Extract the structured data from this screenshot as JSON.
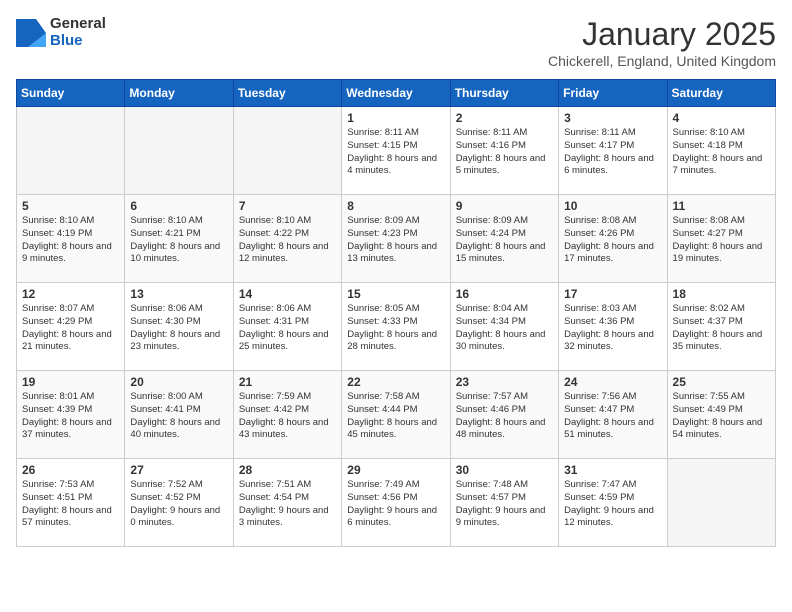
{
  "header": {
    "logo_general": "General",
    "logo_blue": "Blue",
    "month": "January 2025",
    "location": "Chickerell, England, United Kingdom"
  },
  "weekdays": [
    "Sunday",
    "Monday",
    "Tuesday",
    "Wednesday",
    "Thursday",
    "Friday",
    "Saturday"
  ],
  "weeks": [
    [
      {
        "day": null,
        "sunrise": null,
        "sunset": null,
        "daylight": null
      },
      {
        "day": null,
        "sunrise": null,
        "sunset": null,
        "daylight": null
      },
      {
        "day": null,
        "sunrise": null,
        "sunset": null,
        "daylight": null
      },
      {
        "day": "1",
        "sunrise": "8:11 AM",
        "sunset": "4:15 PM",
        "daylight": "8 hours and 4 minutes."
      },
      {
        "day": "2",
        "sunrise": "8:11 AM",
        "sunset": "4:16 PM",
        "daylight": "8 hours and 5 minutes."
      },
      {
        "day": "3",
        "sunrise": "8:11 AM",
        "sunset": "4:17 PM",
        "daylight": "8 hours and 6 minutes."
      },
      {
        "day": "4",
        "sunrise": "8:10 AM",
        "sunset": "4:18 PM",
        "daylight": "8 hours and 7 minutes."
      }
    ],
    [
      {
        "day": "5",
        "sunrise": "8:10 AM",
        "sunset": "4:19 PM",
        "daylight": "8 hours and 9 minutes."
      },
      {
        "day": "6",
        "sunrise": "8:10 AM",
        "sunset": "4:21 PM",
        "daylight": "8 hours and 10 minutes."
      },
      {
        "day": "7",
        "sunrise": "8:10 AM",
        "sunset": "4:22 PM",
        "daylight": "8 hours and 12 minutes."
      },
      {
        "day": "8",
        "sunrise": "8:09 AM",
        "sunset": "4:23 PM",
        "daylight": "8 hours and 13 minutes."
      },
      {
        "day": "9",
        "sunrise": "8:09 AM",
        "sunset": "4:24 PM",
        "daylight": "8 hours and 15 minutes."
      },
      {
        "day": "10",
        "sunrise": "8:08 AM",
        "sunset": "4:26 PM",
        "daylight": "8 hours and 17 minutes."
      },
      {
        "day": "11",
        "sunrise": "8:08 AM",
        "sunset": "4:27 PM",
        "daylight": "8 hours and 19 minutes."
      }
    ],
    [
      {
        "day": "12",
        "sunrise": "8:07 AM",
        "sunset": "4:29 PM",
        "daylight": "8 hours and 21 minutes."
      },
      {
        "day": "13",
        "sunrise": "8:06 AM",
        "sunset": "4:30 PM",
        "daylight": "8 hours and 23 minutes."
      },
      {
        "day": "14",
        "sunrise": "8:06 AM",
        "sunset": "4:31 PM",
        "daylight": "8 hours and 25 minutes."
      },
      {
        "day": "15",
        "sunrise": "8:05 AM",
        "sunset": "4:33 PM",
        "daylight": "8 hours and 28 minutes."
      },
      {
        "day": "16",
        "sunrise": "8:04 AM",
        "sunset": "4:34 PM",
        "daylight": "8 hours and 30 minutes."
      },
      {
        "day": "17",
        "sunrise": "8:03 AM",
        "sunset": "4:36 PM",
        "daylight": "8 hours and 32 minutes."
      },
      {
        "day": "18",
        "sunrise": "8:02 AM",
        "sunset": "4:37 PM",
        "daylight": "8 hours and 35 minutes."
      }
    ],
    [
      {
        "day": "19",
        "sunrise": "8:01 AM",
        "sunset": "4:39 PM",
        "daylight": "8 hours and 37 minutes."
      },
      {
        "day": "20",
        "sunrise": "8:00 AM",
        "sunset": "4:41 PM",
        "daylight": "8 hours and 40 minutes."
      },
      {
        "day": "21",
        "sunrise": "7:59 AM",
        "sunset": "4:42 PM",
        "daylight": "8 hours and 43 minutes."
      },
      {
        "day": "22",
        "sunrise": "7:58 AM",
        "sunset": "4:44 PM",
        "daylight": "8 hours and 45 minutes."
      },
      {
        "day": "23",
        "sunrise": "7:57 AM",
        "sunset": "4:46 PM",
        "daylight": "8 hours and 48 minutes."
      },
      {
        "day": "24",
        "sunrise": "7:56 AM",
        "sunset": "4:47 PM",
        "daylight": "8 hours and 51 minutes."
      },
      {
        "day": "25",
        "sunrise": "7:55 AM",
        "sunset": "4:49 PM",
        "daylight": "8 hours and 54 minutes."
      }
    ],
    [
      {
        "day": "26",
        "sunrise": "7:53 AM",
        "sunset": "4:51 PM",
        "daylight": "8 hours and 57 minutes."
      },
      {
        "day": "27",
        "sunrise": "7:52 AM",
        "sunset": "4:52 PM",
        "daylight": "9 hours and 0 minutes."
      },
      {
        "day": "28",
        "sunrise": "7:51 AM",
        "sunset": "4:54 PM",
        "daylight": "9 hours and 3 minutes."
      },
      {
        "day": "29",
        "sunrise": "7:49 AM",
        "sunset": "4:56 PM",
        "daylight": "9 hours and 6 minutes."
      },
      {
        "day": "30",
        "sunrise": "7:48 AM",
        "sunset": "4:57 PM",
        "daylight": "9 hours and 9 minutes."
      },
      {
        "day": "31",
        "sunrise": "7:47 AM",
        "sunset": "4:59 PM",
        "daylight": "9 hours and 12 minutes."
      },
      {
        "day": null,
        "sunrise": null,
        "sunset": null,
        "daylight": null
      }
    ]
  ],
  "labels": {
    "sunrise_prefix": "Sunrise:",
    "sunset_prefix": "Sunset:",
    "daylight_label": "Daylight:"
  }
}
